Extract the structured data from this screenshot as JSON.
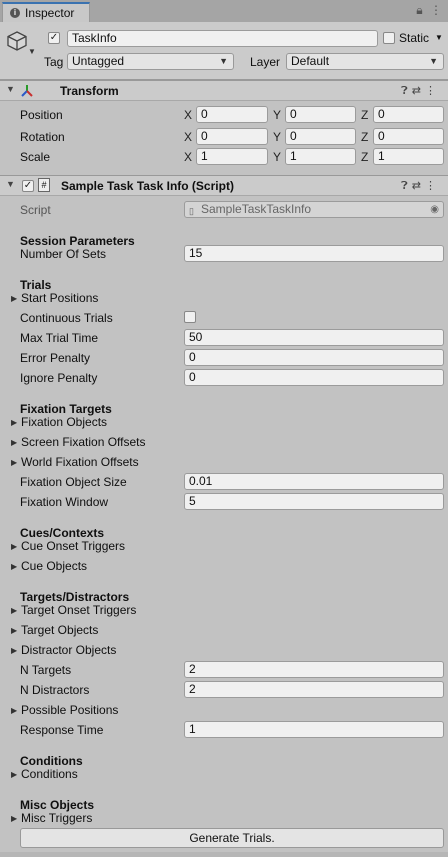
{
  "window": {
    "tab": "Inspector"
  },
  "object": {
    "name": "TaskInfo",
    "active": true,
    "static_label": "Static",
    "static_checked": false,
    "tag_label": "Tag",
    "tag_value": "Untagged",
    "layer_label": "Layer",
    "layer_value": "Default"
  },
  "transform": {
    "title": "Transform",
    "rows": [
      {
        "label": "Position",
        "x": "0",
        "y": "0",
        "z": "0"
      },
      {
        "label": "Rotation",
        "x": "0",
        "y": "0",
        "z": "0"
      },
      {
        "label": "Scale",
        "x": "1",
        "y": "1",
        "z": "1"
      }
    ],
    "axis_x": "X",
    "axis_y": "Y",
    "axis_z": "Z"
  },
  "script_component": {
    "title": "Sample Task Task Info (Script)",
    "script_label": "Script",
    "script_value": "SampleTaskTaskInfo"
  },
  "session": {
    "header": "Session Parameters",
    "number_of_sets_label": "Number Of Sets",
    "number_of_sets": "15"
  },
  "trials": {
    "header": "Trials",
    "start_positions": "Start Positions",
    "continuous_trials_label": "Continuous Trials",
    "continuous_trials": false,
    "max_trial_time_label": "Max Trial Time",
    "max_trial_time": "50",
    "error_penalty_label": "Error Penalty",
    "error_penalty": "0",
    "ignore_penalty_label": "Ignore Penalty",
    "ignore_penalty": "0"
  },
  "fixation": {
    "header": "Fixation Targets",
    "objects": "Fixation Objects",
    "screen_offsets": "Screen Fixation Offsets",
    "world_offsets": "World Fixation Offsets",
    "size_label": "Fixation Object Size",
    "size": "0.01",
    "window_label": "Fixation Window",
    "window": "5"
  },
  "cues": {
    "header": "Cues/Contexts",
    "onset_triggers": "Cue Onset Triggers",
    "objects": "Cue Objects"
  },
  "targets": {
    "header": "Targets/Distractors",
    "onset_triggers": "Target Onset Triggers",
    "target_objects": "Target Objects",
    "distractor_objects": "Distractor Objects",
    "n_targets_label": "N Targets",
    "n_targets": "2",
    "n_distractors_label": "N Distractors",
    "n_distractors": "2",
    "possible_positions": "Possible Positions",
    "response_time_label": "Response Time",
    "response_time": "1"
  },
  "conditions": {
    "header": "Conditions",
    "item": "Conditions"
  },
  "misc": {
    "header": "Misc Objects",
    "item": "Misc Triggers"
  },
  "generate_button": "Generate Trials."
}
